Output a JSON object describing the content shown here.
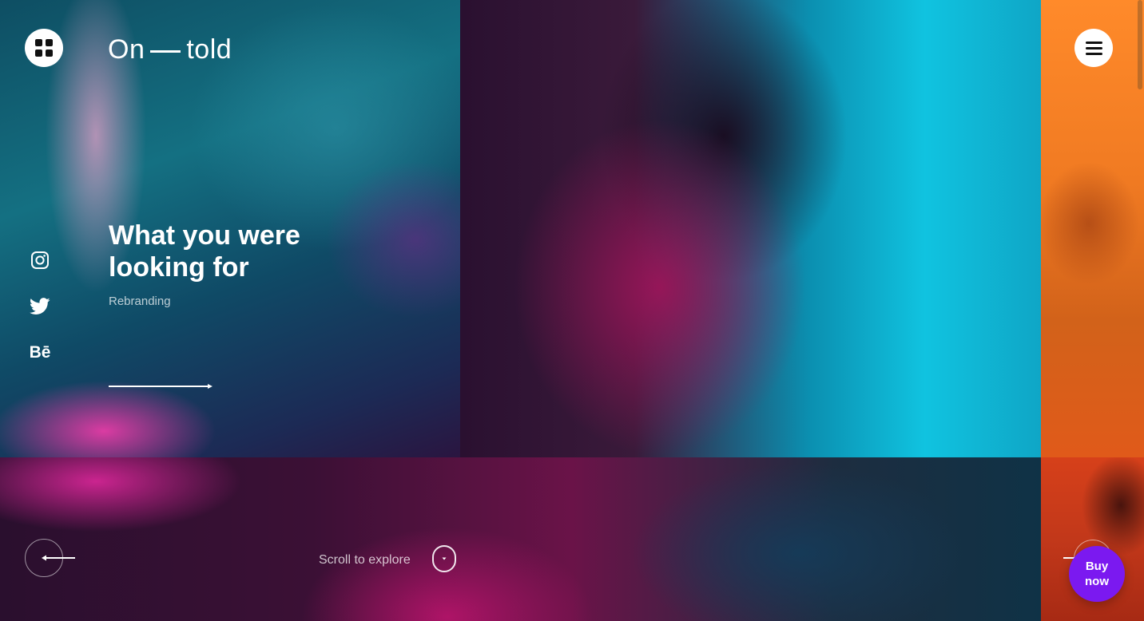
{
  "header": {
    "logo_left": "On",
    "logo_right": "told",
    "grid_icon": "grid-icon",
    "menu_icon": "hamburger-menu-icon"
  },
  "social": [
    {
      "name": "instagram-icon"
    },
    {
      "name": "twitter-icon"
    },
    {
      "name": "behance-icon",
      "text": "Bē"
    }
  ],
  "hero": {
    "headline": "What you were looking for",
    "subtitle": "Rebranding",
    "cta_icon": "long-arrow-right-icon"
  },
  "footer": {
    "scroll_label": "Scroll to explore",
    "prev_icon": "arrow-left-icon",
    "scroll_icon": "chevron-down-icon",
    "buy_label": "Buy\nnow"
  },
  "colors": {
    "buy_button": "#7b19f0",
    "right_panel": "#ff8a2a",
    "white": "#ffffff"
  }
}
